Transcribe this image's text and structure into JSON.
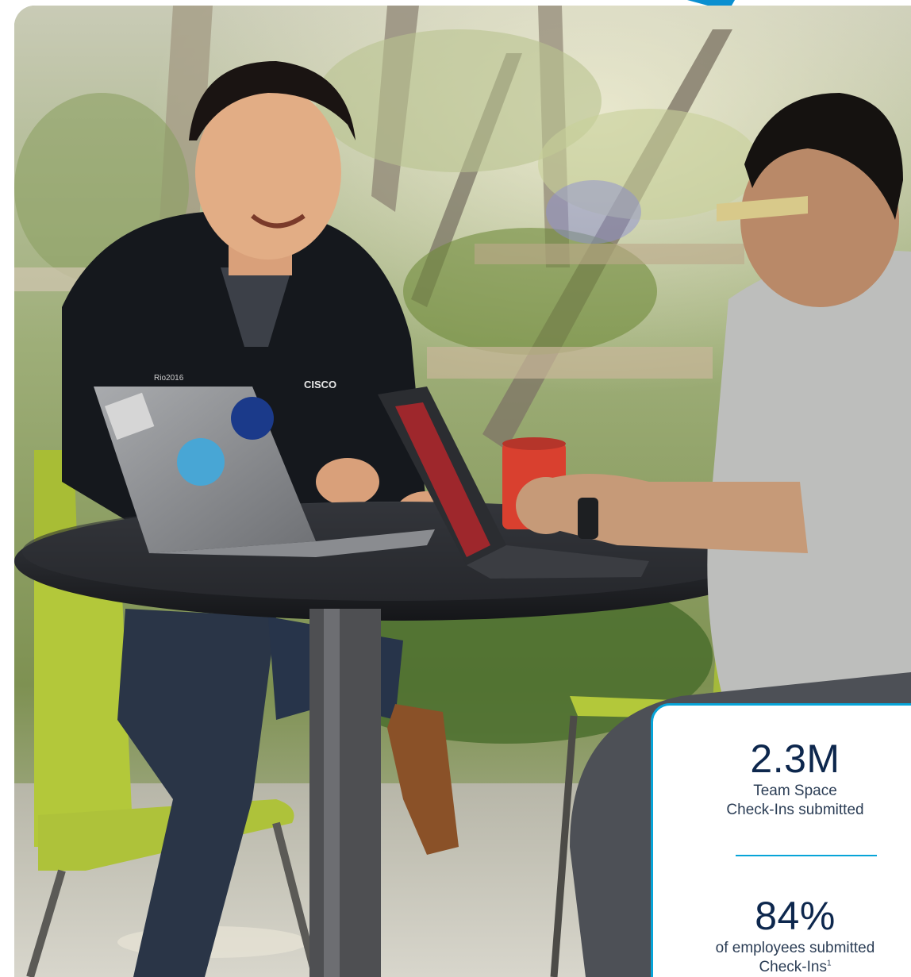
{
  "photo": {
    "subject": "two-people-meeting-at-outdoor-cafe-table-with-laptops",
    "jacket_logo": "Cisco",
    "colors": {
      "foliage": "#7f9a4c",
      "chair": "#b9cc3c",
      "jacket": "#15181d",
      "shirt": "#bcbdbb",
      "mug": "#d9402f",
      "table": "#222428"
    }
  },
  "stats": {
    "primary_value": "2.3M",
    "primary_label_line1": "Team Space",
    "primary_label_line2": "Check-Ins submitted",
    "secondary_value": "84%",
    "secondary_label_line1": "of employees submitted",
    "secondary_label_line2": "Check-Ins",
    "secondary_footnote": "1"
  },
  "accent_color": "#07a4d8",
  "text_color": "#0d274d"
}
